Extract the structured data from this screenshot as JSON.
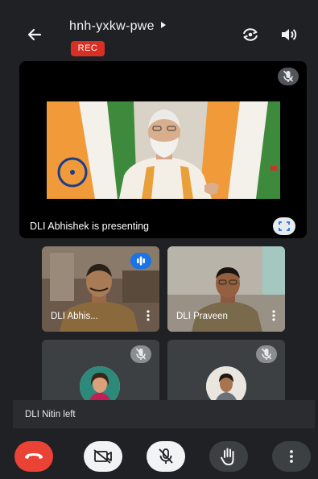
{
  "header": {
    "meeting_code": "hnh-yxkw-pwe",
    "recording_badge": "REC",
    "icons": [
      "back-arrow-icon",
      "switch-camera-icon",
      "speaker-icon"
    ]
  },
  "presentation": {
    "presenter_label": "DLI Abhishek is presenting",
    "icons": [
      "mic-off-icon",
      "fullscreen-icon"
    ]
  },
  "participants": [
    {
      "name": "DLI Abhis...",
      "state": "speaking",
      "video": true
    },
    {
      "name": "DLI Praveen",
      "state": "video",
      "video": true
    },
    {
      "name": "",
      "state": "muted",
      "video": false,
      "avatar": "woman-avatar"
    },
    {
      "name": "",
      "state": "muted",
      "video": false,
      "avatar": "man-avatar"
    }
  ],
  "status": {
    "message": "DLI Nitin left"
  },
  "controls": {
    "items": [
      "end-call",
      "camera-off",
      "mic-off",
      "raise-hand",
      "more-options"
    ],
    "colors": {
      "end_call": "#ea4335",
      "button_light": "#f1f3f4",
      "button_dark": "#3c4043"
    }
  },
  "colors": {
    "background": "#202124",
    "rec_badge": "#d93025",
    "speaking": "#1a73e8"
  }
}
